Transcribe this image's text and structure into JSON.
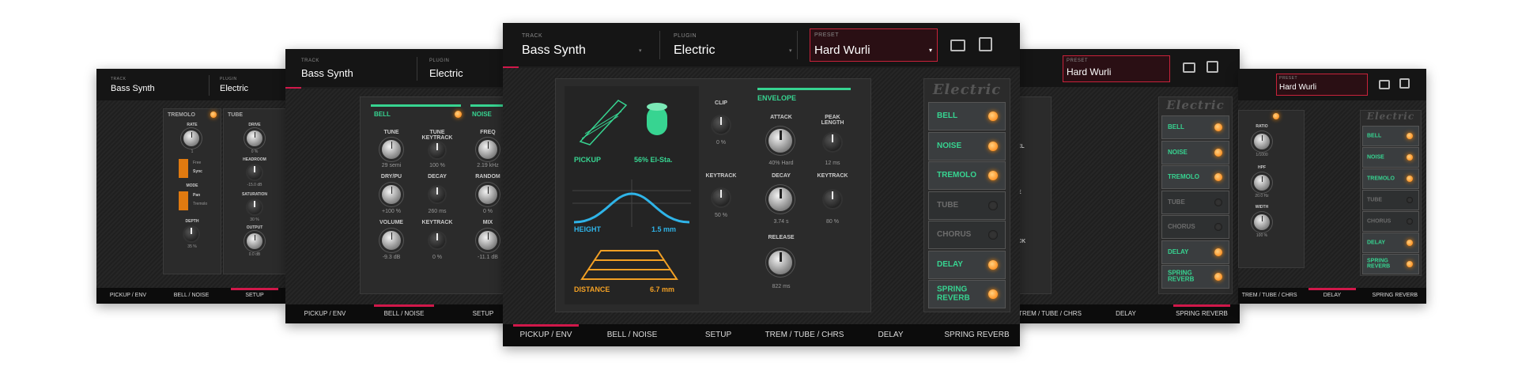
{
  "header": {
    "track_label": "TRACK",
    "track_value": "Bass Synth",
    "plugin_label": "PLUGIN",
    "plugin_value": "Electric",
    "preset_label": "PRESET",
    "preset_value": "Hard Wurli"
  },
  "tabs": [
    "PICKUP / ENV",
    "BELL / NOISE",
    "SETUP",
    "TREM / TUBE / CHRS",
    "DELAY",
    "SPRING REVERB"
  ],
  "logo": "Electric",
  "effects": [
    {
      "label": "BELL",
      "on": true
    },
    {
      "label": "NOISE",
      "on": true
    },
    {
      "label": "TREMOLO",
      "on": true
    },
    {
      "label": "TUBE",
      "on": false
    },
    {
      "label": "CHORUS",
      "on": false
    },
    {
      "label": "DELAY",
      "on": true
    },
    {
      "label": "SPRING REVERB",
      "on": true
    }
  ],
  "pickup": {
    "title": "PICKUP",
    "material": "56% El-Sta.",
    "height_label": "HEIGHT",
    "height_value": "1.5 mm",
    "distance_label": "DISTANCE",
    "distance_value": "6.7 mm",
    "clip_label": "CLIP",
    "clip_value": "0 %",
    "keytrack_label": "KEYTRACK",
    "keytrack_value": "50 %"
  },
  "envelope": {
    "title": "ENVELOPE",
    "attack_label": "ATTACK",
    "attack_value": "40% Hard",
    "peak_label": "PEAK LENGTH",
    "peak_value": "12 ms",
    "decay_label": "DECAY",
    "decay_value": "3.74 s",
    "keytrack_label": "KEYTRACK",
    "keytrack_value": "80 %",
    "release_label": "RELEASE",
    "release_value": "822 ms"
  },
  "bell": {
    "title": "BELL",
    "tune_label": "TUNE",
    "tune_value": "29 semi",
    "tunekey_label": "TUNE KEYTRACK",
    "tunekey_value": "100 %",
    "drypu_label": "DRY/PU",
    "drypu_value": "+100 %",
    "decay_label": "DECAY",
    "decay_value": "260 ms",
    "volume_label": "VOLUME",
    "volume_value": "-9.3 dB",
    "keytrack_label": "KEYTRACK",
    "keytrack_value": "0 %"
  },
  "noise": {
    "title": "NOISE",
    "freq_label": "FREQ",
    "freq_value": "2.19 kHz",
    "random_label": "RANDOM",
    "random_value": "0 %",
    "mix_label": "MIX",
    "mix_value": "-11.1 dB"
  },
  "tremolo": {
    "title": "TREMOLO",
    "rate_label": "RATE",
    "rate_value": "1",
    "free_label": "Free",
    "sync_label": "Sync",
    "mode_label": "MODE",
    "pan_label": "Pan",
    "tremolo_label": "Tremolo",
    "depth_label": "DEPTH",
    "depth_value": "35 %"
  },
  "tube": {
    "title": "TUBE",
    "drive_label": "DRIVE",
    "drive_value": "0 %",
    "headroom_label": "HEADROOM",
    "headroom_value": "-15.0 dB",
    "saturation_label": "SATURATION",
    "saturation_value": "30 %",
    "output_label": "OUTPUT",
    "output_value": "0.0 dB"
  },
  "chorus_partial": {
    "level_label": "VEL",
    "tone_label": "NE",
    "back_label": "ACK"
  },
  "delay_panel": {
    "ratio_label": "RATIO",
    "ratio_value": "1/1000",
    "hpf_label": "HPF",
    "hpf_value": "20.0 Hz",
    "width_label": "WIDTH",
    "width_value": "100 %"
  },
  "colors": {
    "accent": "#d0184a",
    "green": "#37d491",
    "orange": "#f2a024",
    "led": "#ff7a00"
  }
}
